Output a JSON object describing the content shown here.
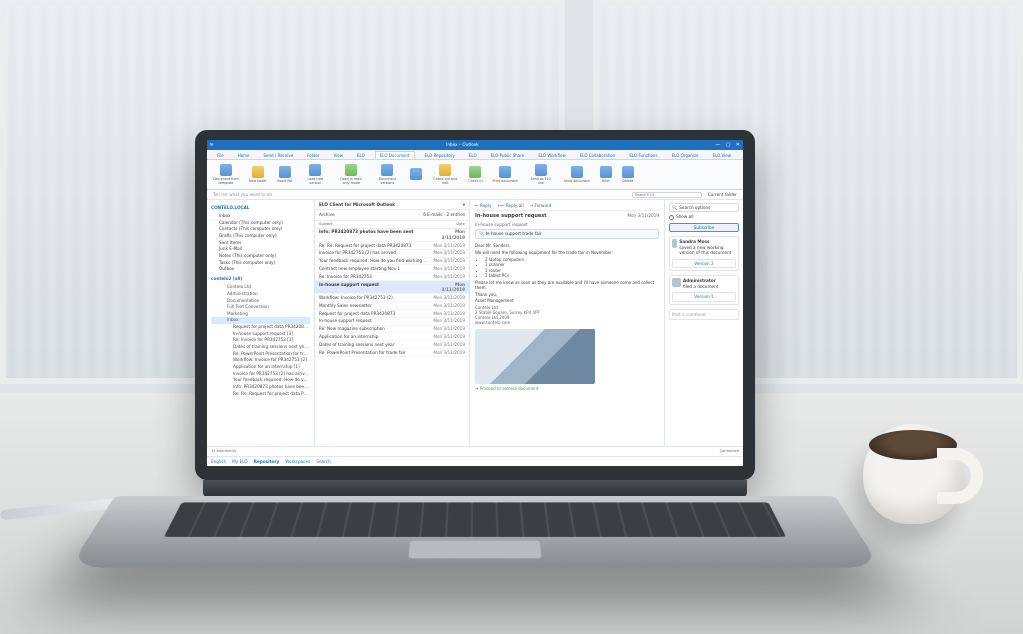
{
  "titlebar": {
    "title": "Inbox – Outlook",
    "min": "—",
    "max": "▢",
    "close": "✕"
  },
  "ribbon_tabs": [
    "File",
    "Home",
    "Send / Receive",
    "Folder",
    "View",
    "ELO",
    "ELO Document",
    "ELO Repository",
    "ELO",
    "ELO Public Share",
    "ELO Workflow",
    "ELO Collaboration",
    "ELO Functions",
    "ELO Organize",
    "ELO View"
  ],
  "tell_me": "Tell me what you want to do",
  "ribbon_groups": [
    {
      "label": "Document from template",
      "icon": "b"
    },
    {
      "label": "New folder",
      "icon": "y"
    },
    {
      "label": "Insert file",
      "icon": "b"
    },
    {
      "label": "Load new version",
      "icon": "b"
    },
    {
      "label": "Open in read-only mode",
      "icon": "g"
    },
    {
      "label": "Document versions",
      "icon": "b"
    },
    {
      "label": "",
      "icon": "b"
    },
    {
      "label": "Check out and edit",
      "icon": "y"
    },
    {
      "label": "Check in",
      "icon": "g"
    },
    {
      "label": "Print document",
      "icon": "b"
    },
    {
      "label": "Send as ELO link",
      "icon": "b"
    },
    {
      "label": "Send document",
      "icon": "b"
    },
    {
      "label": "Filter",
      "icon": "b"
    },
    {
      "label": "Delete",
      "icon": "b"
    }
  ],
  "search": {
    "placeholder": "Search ELO",
    "current": "Current folder"
  },
  "nav": {
    "root": "CONTELO.LOCAL",
    "items": [
      "Inbox",
      "Calendar (This computer only)",
      "Contacts (This computer only)",
      "Drafts (This computer only)",
      "Sent Items",
      "Junk E-Mail",
      "Notes (This computer only)",
      "Tasks (This computer only)",
      "Outbox"
    ],
    "elo_root": "contelo2 (all)",
    "elo_items": [
      "Contelo Ltd.",
      "Administration",
      "Documentation",
      "Full Text Conversion",
      "Marketing",
      "Inbox"
    ],
    "files": [
      "Request for project data PR3420873 [1]",
      "In-house support request [3]",
      "Re: Invoice for PR342753 [1]",
      "Dates of training sessions next year [1]",
      "Re: PowerPoint Presentation for trade fair [1]",
      "Workflow: Invoice for PR342753 [2]",
      "Application for an internship [1]",
      "Invoice for PR342753 (2) has arrived [1]",
      "Your feedback required: How do you find working … [2]",
      "Info: PR3420873 photos have been sent [2]",
      "Re: Re: Request for project data PR3420873 [2]"
    ]
  },
  "maillist": {
    "context": "ELO Client for Microsoft Outlook",
    "breadcrumb": "Archive",
    "count": "6 E-mails · 2 entries",
    "cols": {
      "subject": "Subject",
      "date": "Date"
    },
    "rows": [
      {
        "subject": "Info: PR3420873 photos have been sent",
        "date": "Mon 3/11/2019",
        "bold": true
      },
      {
        "subject": "Re: Re: Request for project data PR3420873",
        "date": "Mon 3/11/2019"
      },
      {
        "subject": "Invoice for PR342753 (2) has arrived",
        "date": "Mon 3/11/2019"
      },
      {
        "subject": "Your feedback required: How do you find working with the new …",
        "date": "Mon 3/11/2019"
      },
      {
        "subject": "Contract new employee starting Nov 1",
        "date": "Mon 3/11/2019"
      },
      {
        "subject": "Re: Invoice for PR342753",
        "date": "Mon 3/11/2019"
      },
      {
        "subject": "In-house support request",
        "date": "Mon 3/11/2019",
        "selected": true,
        "bold": true
      },
      {
        "subject": "Workflow: Invoice for PR342753 (2)",
        "date": "Mon 3/11/2019"
      },
      {
        "subject": "Monthly Sales newsletter",
        "date": "Mon 3/11/2019"
      },
      {
        "subject": "Request for project data PR3420873",
        "date": "Mon 3/11/2019"
      },
      {
        "subject": "In-house support request",
        "date": "Mon 3/11/2019"
      },
      {
        "subject": "Re: New magazine subscription",
        "date": "Mon 3/11/2019"
      },
      {
        "subject": "Application for an internship",
        "date": "Mon 3/11/2019"
      },
      {
        "subject": "Dates of training sessions next year",
        "date": "Mon 3/11/2019"
      },
      {
        "subject": "Re: PowerPoint Presentation for trade fair",
        "date": "Mon 3/11/2019"
      }
    ],
    "footer_count": "15 element(s)"
  },
  "message": {
    "actions": [
      "Reply",
      "Reply all",
      "Forward"
    ],
    "date": "Mon 3/11/2019",
    "subject": "In-house support request",
    "from": "In-house support request",
    "attachment": "In-house support trade fair",
    "greeting": "Dear Mr. Sanders,",
    "intro": "We will need the following equipment for the trade fair in November:",
    "bullets": [
      "2 laptop computers",
      "1 scanner",
      "1 router",
      "2 tablet PCs"
    ],
    "para": "Please let me know as soon as they are available and I'll have someone come and collect them.",
    "thanks": "Thank you,",
    "sig_dept": "Asset Management",
    "sig_lines": "Contelo Ltd\n2 Stable Square, Surrey KP4 4PF\nContelo Ltd 2009\nwww.contelo.com",
    "link": "Proceed to archive document"
  },
  "sidepanel": {
    "search_label": "Search options",
    "show_all": "Show all",
    "subscribe": "Subscribe",
    "versions": [
      "Version 2",
      "Version 1"
    ],
    "activity": [
      {
        "name": "Sandra Moss",
        "action": "saved a new working version of this document"
      },
      {
        "name": "Administrator",
        "action": "filed a document"
      }
    ],
    "write": "Post a comment"
  },
  "footnav": {
    "items": [
      "English",
      "My ELO",
      "Repository",
      "Workspaces",
      "Search"
    ],
    "active": "Repository",
    "status": "Connected"
  }
}
